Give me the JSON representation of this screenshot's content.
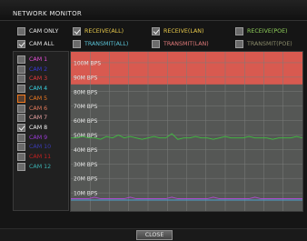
{
  "window": {
    "title": "NETWORK MONITOR"
  },
  "filters": {
    "cam_only": {
      "label": "CAM ONLY",
      "checked": false
    },
    "cam_all": {
      "label": "CAM ALL",
      "checked": true
    }
  },
  "traffic_filters": [
    {
      "label": "RECEIVE(ALL)",
      "checked": true,
      "color": "#e6c84a"
    },
    {
      "label": "RECEIVE(LAN)",
      "checked": true,
      "color": "#e6c84a"
    },
    {
      "label": "RECEIVE(POE)",
      "checked": false,
      "color": "#8fcf5a"
    },
    {
      "label": "TRANSMIT(ALL)",
      "checked": false,
      "color": "#5ac3d6"
    },
    {
      "label": "TRANSMIT(LAN)",
      "checked": false,
      "color": "#e07a7a"
    },
    {
      "label": "TRANSMIT(POE)",
      "checked": false,
      "color": "#8a8a6a"
    }
  ],
  "cameras": [
    {
      "label": "CAM 1",
      "checked": false,
      "color": "#e64fd8"
    },
    {
      "label": "CAM 2",
      "checked": false,
      "color": "#3a3ad6"
    },
    {
      "label": "CAM 3",
      "checked": false,
      "color": "#e63a3a"
    },
    {
      "label": "CAM 4",
      "checked": false,
      "color": "#3ad6e6"
    },
    {
      "label": "CAM 5",
      "checked": false,
      "color": "#f07a20",
      "selected": true
    },
    {
      "label": "CAM 6",
      "checked": false,
      "color": "#e67a5a"
    },
    {
      "label": "CAM 7",
      "checked": false,
      "color": "#e6a0a0"
    },
    {
      "label": "CAM 8",
      "checked": true,
      "color": "#f2f2f2"
    },
    {
      "label": "CAM 9",
      "checked": false,
      "color": "#9a3ad6"
    },
    {
      "label": "CAM 10",
      "checked": false,
      "color": "#3a3ab0"
    },
    {
      "label": "CAM 11",
      "checked": false,
      "color": "#c02020"
    },
    {
      "label": "CAM 12",
      "checked": false,
      "color": "#3ab0b0"
    }
  ],
  "graph": {
    "y_labels": [
      "100M BPS",
      "90M BPS",
      "80M BPS",
      "70M BPS",
      "60M BPS",
      "50M BPS",
      "40M BPS",
      "30M BPS",
      "20M BPS",
      "10M BPS"
    ],
    "y_values": [
      100,
      90,
      80,
      70,
      60,
      50,
      40,
      30,
      20,
      10
    ],
    "limit_zone_from": 85,
    "colors": {
      "background": "#555755",
      "limit_zone": "#d85a50",
      "grid": "#7a7c7a",
      "line_main": "#3fbf3f",
      "line_low_1": "#b04ad0",
      "line_low_2": "#4aa0d0"
    },
    "series_main": [
      48,
      48,
      49,
      48,
      48,
      47,
      49,
      48,
      50,
      48,
      49,
      48,
      47,
      48,
      49,
      48,
      48,
      51,
      47,
      48,
      48,
      49,
      48,
      48,
      47,
      48,
      49,
      48,
      48,
      48,
      49,
      48,
      48,
      48,
      47,
      48,
      48,
      48,
      49,
      48
    ],
    "series_low_1": [
      6,
      6,
      6,
      6,
      7,
      6,
      6,
      6,
      6,
      6,
      7,
      6,
      6,
      6,
      6,
      6,
      6,
      7,
      6,
      6,
      6,
      6,
      6,
      6,
      7,
      6,
      6,
      6,
      6,
      6,
      6,
      7,
      6,
      6,
      6,
      6,
      6,
      6,
      6,
      6
    ],
    "series_low_2": [
      5,
      5,
      5,
      5,
      5,
      5,
      5,
      5,
      5,
      5,
      5,
      5,
      5,
      5,
      5,
      5,
      5,
      5,
      5,
      5,
      5,
      5,
      5,
      5,
      5,
      5,
      5,
      5,
      5,
      5,
      5,
      5,
      5,
      5,
      5,
      5,
      5,
      5,
      5,
      5
    ]
  },
  "footer": {
    "close_label": "CLOSE"
  }
}
